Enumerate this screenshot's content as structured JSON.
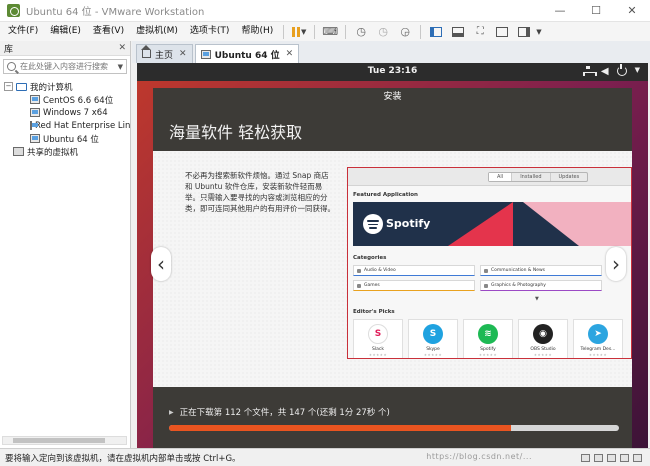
{
  "window": {
    "title": "Ubuntu 64 位 - VMware Workstation"
  },
  "menu": [
    "文件(F)",
    "编辑(E)",
    "查看(V)",
    "虚拟机(M)",
    "选项卡(T)",
    "帮助(H)"
  ],
  "library": {
    "title": "库",
    "search_placeholder": "在此处键入内容进行搜索",
    "root": "我的计算机",
    "vms": [
      "CentOS 6.6 64位",
      "Windows 7 x64",
      "Red Hat Enterprise Lin",
      "Ubuntu 64 位"
    ],
    "shared": "共享的虚拟机"
  },
  "tabs": [
    {
      "label": "主页"
    },
    {
      "label": "Ubuntu 64 位"
    }
  ],
  "guest": {
    "clock": "Tue 23:16",
    "installer_title": "安装",
    "heading": "海量软件 轻松获取",
    "description": "不必再为搜索新软件烦恼。通过 Snap 商店和 Ubuntu 软件仓库，安装新软件轻而易举。只需输入要寻找的内容或浏览相应的分类，即可连同其他用户的有用评价一同获得。",
    "store": {
      "segments": [
        "All",
        "Installed",
        "Updates"
      ],
      "featured_label": "Featured Application",
      "featured_app": "Spotify",
      "categories_label": "Categories",
      "categories": [
        "Audio & Video",
        "Communication & News",
        "Games",
        "Graphics & Photography"
      ],
      "picks_label": "Editor's Picks",
      "picks": [
        {
          "name": "Slack",
          "glyph": "S",
          "color": "#ffffff"
        },
        {
          "name": "Skype",
          "glyph": "S",
          "color": "#1fa2e0"
        },
        {
          "name": "Spotify",
          "glyph": "≋",
          "color": "#1db954"
        },
        {
          "name": "OBS Studio",
          "glyph": "◉",
          "color": "#222222"
        },
        {
          "name": "Telegram Des...",
          "glyph": "➤",
          "color": "#2ca5e0"
        }
      ]
    },
    "progress_text": "正在下载第 112 个文件，共 147 个(还剩 1分 27秒 个)",
    "progress_fraction": 0.76
  },
  "status": {
    "hint": "要将输入定向到该虚拟机，请在虚拟机内部单击或按 Ctrl+G。",
    "watermark": "https://blog.csdn.net/..."
  }
}
